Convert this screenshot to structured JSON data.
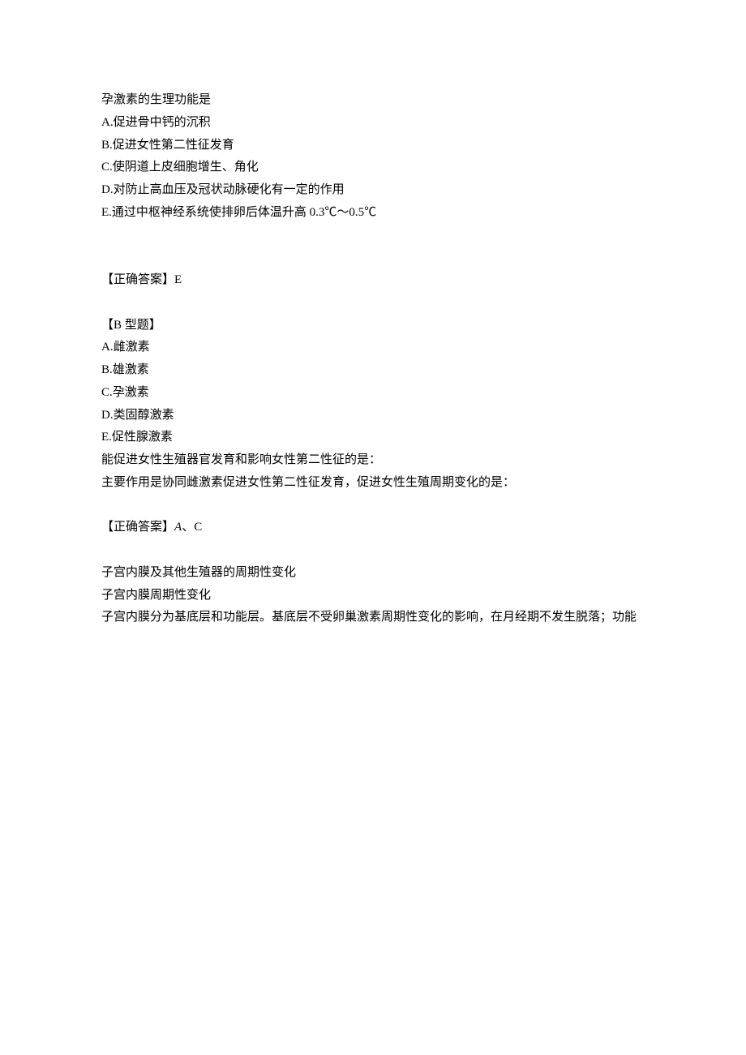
{
  "q1": {
    "stem": "孕激素的生理功能是",
    "options": {
      "a": "A.促进骨中钙的沉积",
      "b": "B.促进女性第二性征发育",
      "c": "C.使阴道上皮细胞增生、角化",
      "d": "D.对防止高血压及冠状动脉硬化有一定的作用",
      "e": "E.通过中枢神经系统使排卵后体温升高 0.3℃～0.5℃"
    },
    "answer_label": "【正确答案】E"
  },
  "q2": {
    "header": "【B 型题】",
    "options": {
      "a": "A.雌激素",
      "b": "B.雄激素",
      "c": "C.孕激素",
      "d": "D.类固醇激素",
      "e": "E.促性腺激素"
    },
    "sub1": "能促进女性生殖器官发育和影响女性第二性征的是：",
    "sub2": "主要作用是协同雌激素促进女性第二性征发育，促进女性生殖周期变化的是：",
    "answer_prefix": "【正确答案】",
    "answer_a": "A",
    "answer_sep": "、C"
  },
  "section": {
    "line1": "子宫内膜及其他生殖器的周期性变化",
    "line2": "子宫内膜周期性变化",
    "line3": "子宫内膜分为基底层和功能层。基底层不受卵巢激素周期性变化的影响，在月经期不发生脱落；功能"
  }
}
